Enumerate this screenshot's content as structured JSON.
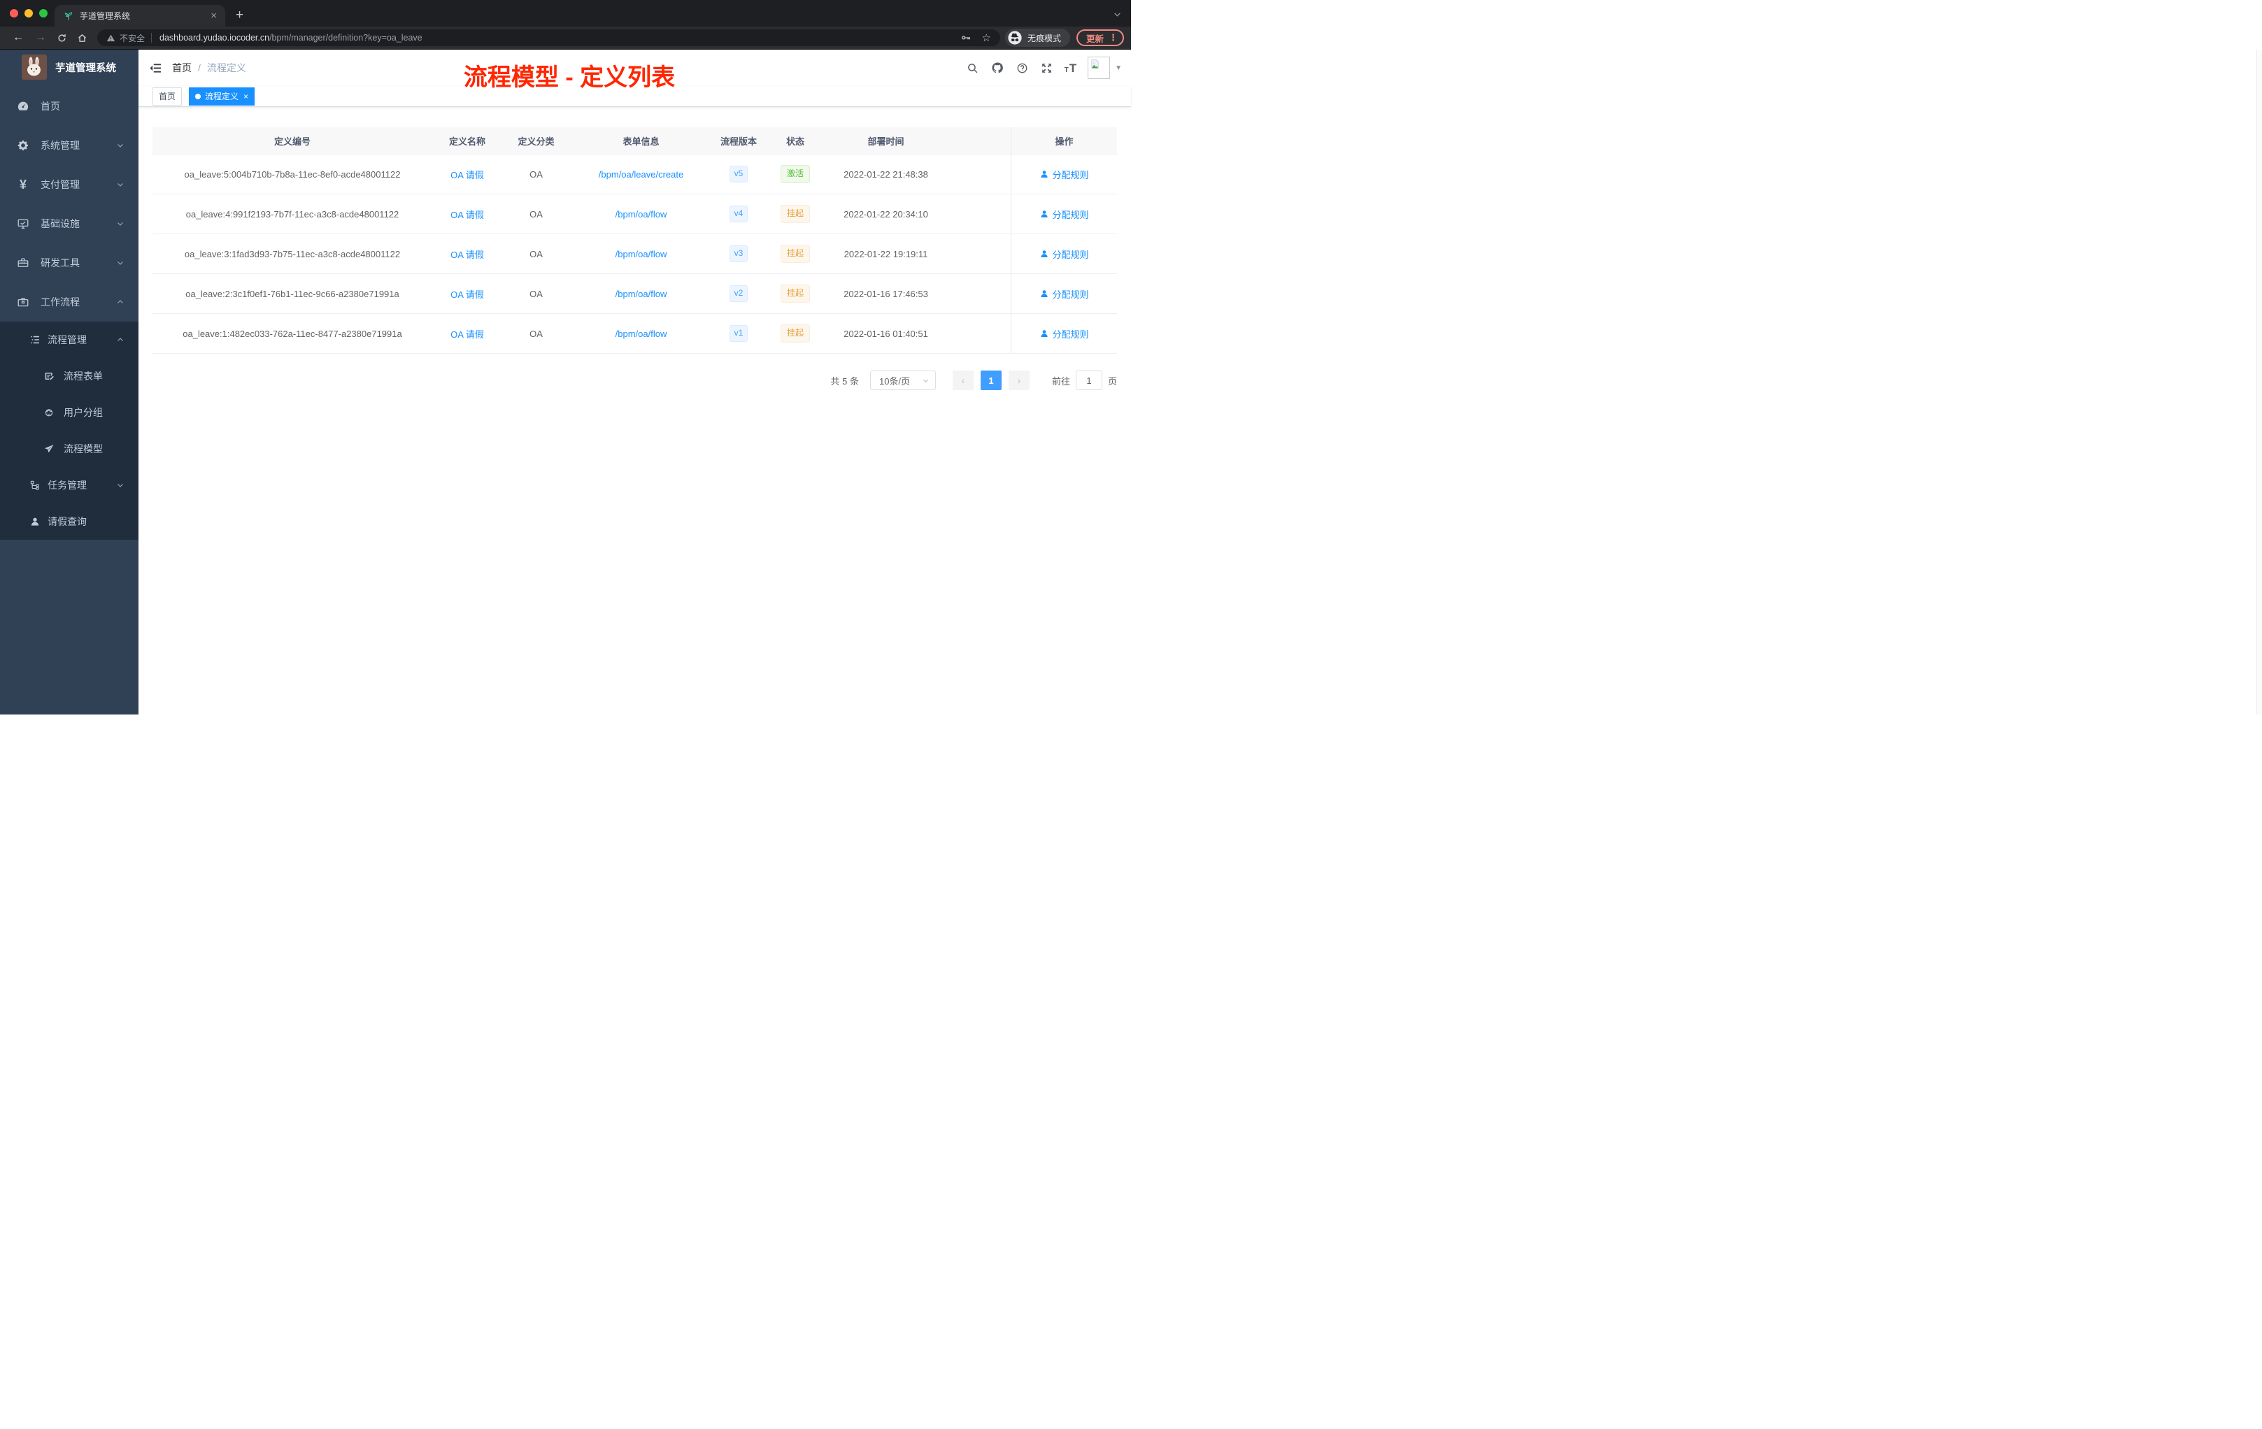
{
  "browser": {
    "tab": {
      "title": "芋道管理系统"
    },
    "address": {
      "security": "不安全",
      "host": "dashboard.yudao.iocoder.cn",
      "path": "/bpm/manager/definition?key=oa_leave"
    },
    "incognito_label": "无痕模式",
    "update_label": "更新"
  },
  "icons": {
    "back": "←",
    "forward": "→",
    "star": "☆",
    "caret_down": "▼",
    "tab_close": "×",
    "new_tab": "+",
    "kebab": "⋮",
    "tag_close": "×",
    "prev_page": "‹",
    "next_page": "›",
    "font_letter_small": "T",
    "font_letter_big": "T"
  },
  "sidebar": {
    "title": "芋道管理系统",
    "menu": [
      {
        "label": "首页",
        "icon": "dashboard-icon",
        "level": 1
      },
      {
        "label": "系统管理",
        "icon": "gear-icon",
        "level": 1,
        "state": "collapsed"
      },
      {
        "label": "支付管理",
        "icon": "yen-icon",
        "level": 1,
        "state": "collapsed"
      },
      {
        "label": "基础设施",
        "icon": "monitor-icon",
        "level": 1,
        "state": "collapsed"
      },
      {
        "label": "研发工具",
        "icon": "toolbox-icon",
        "level": 1,
        "state": "collapsed"
      },
      {
        "label": "工作流程",
        "icon": "briefcase-icon",
        "level": 1,
        "state": "expanded"
      },
      {
        "label": "流程管理",
        "icon": "tree-table-icon",
        "level": 2,
        "state": "expanded"
      },
      {
        "label": "流程表单",
        "icon": "form-icon",
        "level": 3
      },
      {
        "label": "用户分组",
        "icon": "user-group-icon",
        "level": 3
      },
      {
        "label": "流程模型",
        "icon": "send-icon",
        "level": 3
      },
      {
        "label": "任务管理",
        "icon": "tree-icon",
        "level": 2,
        "state": "collapsed"
      },
      {
        "label": "请假查询",
        "icon": "user-icon",
        "level": 2
      }
    ]
  },
  "navbar": {
    "breadcrumb": [
      "首页",
      "流程定义"
    ],
    "breadcrumb_separator": "/",
    "annotation": "流程模型 - 定义列表"
  },
  "tags_view": {
    "tags": [
      {
        "label": "首页",
        "active": false
      },
      {
        "label": "流程定义",
        "active": true,
        "closable": true
      }
    ]
  },
  "table": {
    "columns": [
      "定义编号",
      "定义名称",
      "定义分类",
      "表单信息",
      "流程版本",
      "状态",
      "部署时间",
      "操作"
    ],
    "rows": [
      {
        "id": "oa_leave:5:004b710b-7b8a-11ec-8ef0-acde48001122",
        "name": "OA 请假",
        "category": "OA",
        "form": "/bpm/oa/leave/create",
        "version": "v5",
        "status": "激活",
        "status_type": "success",
        "deploy_time": "2022-01-22 21:48:38",
        "action": "分配规则"
      },
      {
        "id": "oa_leave:4:991f2193-7b7f-11ec-a3c8-acde48001122",
        "name": "OA 请假",
        "category": "OA",
        "form": "/bpm/oa/flow",
        "version": "v4",
        "status": "挂起",
        "status_type": "warning",
        "deploy_time": "2022-01-22 20:34:10",
        "action": "分配规则"
      },
      {
        "id": "oa_leave:3:1fad3d93-7b75-11ec-a3c8-acde48001122",
        "name": "OA 请假",
        "category": "OA",
        "form": "/bpm/oa/flow",
        "version": "v3",
        "status": "挂起",
        "status_type": "warning",
        "deploy_time": "2022-01-22 19:19:11",
        "action": "分配规则"
      },
      {
        "id": "oa_leave:2:3c1f0ef1-76b1-11ec-9c66-a2380e71991a",
        "name": "OA 请假",
        "category": "OA",
        "form": "/bpm/oa/flow",
        "version": "v2",
        "status": "挂起",
        "status_type": "warning",
        "deploy_time": "2022-01-16 17:46:53",
        "action": "分配规则"
      },
      {
        "id": "oa_leave:1:482ec033-762a-11ec-8477-a2380e71991a",
        "name": "OA 请假",
        "category": "OA",
        "form": "/bpm/oa/flow",
        "version": "v1",
        "status": "挂起",
        "status_type": "warning",
        "deploy_time": "2022-01-16 01:40:51",
        "action": "分配规则"
      }
    ]
  },
  "pagination": {
    "total": "共 5 条",
    "page_size": "10条/页",
    "current_page": "1",
    "goto_label": "前往",
    "goto_value": "1",
    "unit_label": "页"
  },
  "colors": {
    "accent_blue": "#1890ff",
    "element_blue": "#409eff",
    "success_green": "#58c23a",
    "warning_orange": "#e6a23c",
    "sidebar_bg": "#304156",
    "submenu_bg": "#1f2d3d",
    "annotation_red": "#ff2600",
    "chrome_update_red": "#f28b82",
    "active_tag_bg": "#1890ff"
  }
}
